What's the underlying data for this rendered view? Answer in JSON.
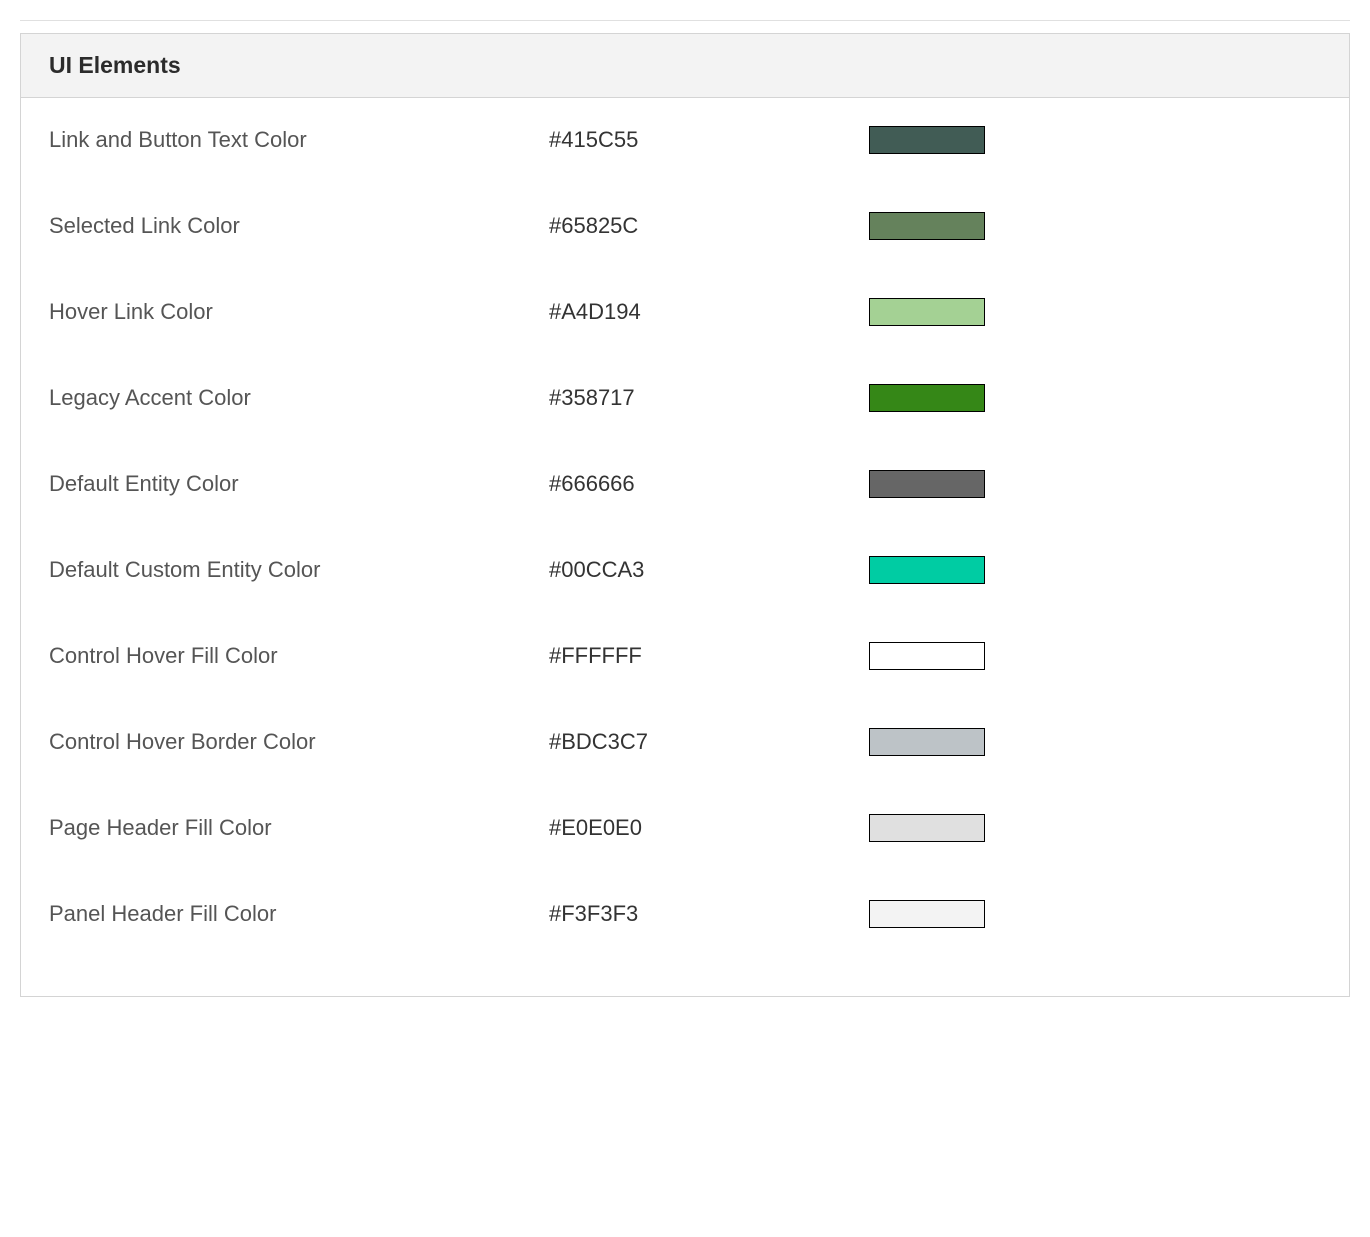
{
  "section": {
    "title": "UI Elements",
    "rows": [
      {
        "label": "Link and Button Text Color",
        "value": "#415C55",
        "color": "#415C55"
      },
      {
        "label": "Selected Link Color",
        "value": "#65825C",
        "color": "#65825C"
      },
      {
        "label": "Hover Link Color",
        "value": "#A4D194",
        "color": "#A4D194"
      },
      {
        "label": "Legacy Accent Color",
        "value": "#358717",
        "color": "#358717"
      },
      {
        "label": "Default Entity Color",
        "value": "#666666",
        "color": "#666666"
      },
      {
        "label": "Default Custom Entity Color",
        "value": "#00CCA3",
        "color": "#00CCA3"
      },
      {
        "label": "Control Hover Fill Color",
        "value": "#FFFFFF",
        "color": "#FFFFFF"
      },
      {
        "label": "Control Hover Border Color",
        "value": "#BDC3C7",
        "color": "#BDC3C7"
      },
      {
        "label": "Page Header Fill Color",
        "value": "#E0E0E0",
        "color": "#E0E0E0"
      },
      {
        "label": "Panel Header Fill Color",
        "value": "#F3F3F3",
        "color": "#F3F3F3"
      }
    ]
  }
}
